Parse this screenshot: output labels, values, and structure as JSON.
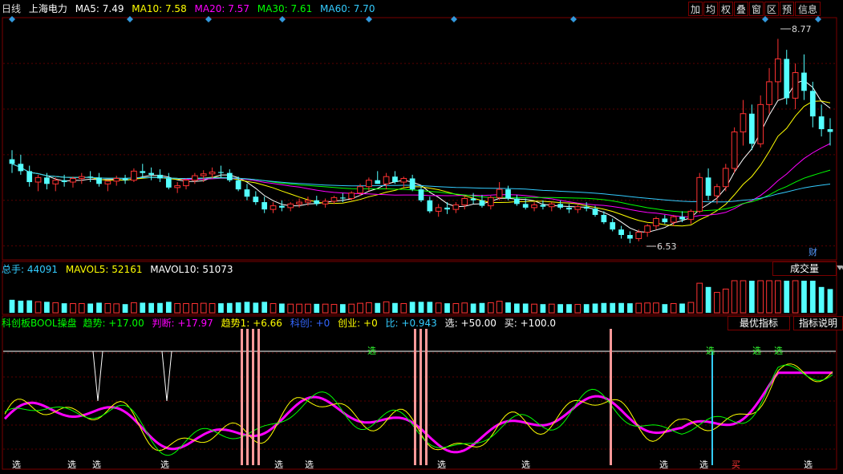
{
  "header": {
    "period": "日线",
    "name": "上海电力",
    "ma": [
      {
        "label": "MA5: 7.49",
        "color": "#ffffff"
      },
      {
        "label": "MA10: 7.58",
        "color": "#ffff00"
      },
      {
        "label": "MA20: 7.57",
        "color": "#ff00ff"
      },
      {
        "label": "MA30: 7.61",
        "color": "#00ff00"
      },
      {
        "label": "MA60: 7.70",
        "color": "#33ccff"
      }
    ]
  },
  "toolbar": [
    {
      "label": "加",
      "name": "toolbar-add-button"
    },
    {
      "label": "均",
      "name": "toolbar-average-button"
    },
    {
      "label": "权",
      "name": "toolbar-rights-button"
    },
    {
      "label": "叠",
      "name": "toolbar-overlay-button"
    },
    {
      "label": "窗",
      "name": "toolbar-window-button"
    },
    {
      "label": "区",
      "name": "toolbar-range-button"
    },
    {
      "label": "预",
      "name": "toolbar-forecast-button"
    },
    {
      "label": "信息",
      "name": "toolbar-info-button"
    }
  ],
  "price_annotations": {
    "high": "8.77",
    "low": "6.53",
    "cai": "财"
  },
  "volume": {
    "items": [
      {
        "label": "总手: 44091",
        "color": "#33ccff"
      },
      {
        "label": "MAVOL5: 52161",
        "color": "#ffff00"
      },
      {
        "label": "MAVOL10: 51073",
        "color": "#ffffff"
      }
    ],
    "tab": "成交量"
  },
  "indicator": {
    "items": [
      {
        "label": "科创板BOOL操盘",
        "color": "#00ff00"
      },
      {
        "label": "趋势: +17.00",
        "color": "#00ff00"
      },
      {
        "label": "判断: +17.97",
        "color": "#ff00ff"
      },
      {
        "label": "趋势1: +6.66",
        "color": "#ffff00"
      },
      {
        "label": "科创: +0",
        "color": "#3366ff"
      },
      {
        "label": "创业: +0",
        "color": "#ffff00"
      },
      {
        "label": "比: +0.943",
        "color": "#33ccff"
      },
      {
        "label": "选: +50.00",
        "color": "#ffffff"
      },
      {
        "label": "买: +100.0",
        "color": "#ffffff"
      }
    ],
    "tabs": [
      "最优指标",
      "指标说明"
    ],
    "signal_select": "选",
    "signal_buy": "买"
  },
  "chart_data": {
    "type": "candlestick",
    "ylim": [
      6.4,
      8.95
    ],
    "grid": true,
    "candles": [
      [
        7.45,
        7.55,
        7.3,
        7.4
      ],
      [
        7.4,
        7.5,
        7.28,
        7.32
      ],
      [
        7.32,
        7.38,
        7.15,
        7.2
      ],
      [
        7.2,
        7.28,
        7.1,
        7.25
      ],
      [
        7.25,
        7.3,
        7.12,
        7.18
      ],
      [
        7.18,
        7.25,
        7.1,
        7.22
      ],
      [
        7.22,
        7.28,
        7.15,
        7.2
      ],
      [
        7.2,
        7.26,
        7.14,
        7.24
      ],
      [
        7.24,
        7.3,
        7.18,
        7.26
      ],
      [
        7.26,
        7.32,
        7.2,
        7.25
      ],
      [
        7.25,
        7.3,
        7.15,
        7.18
      ],
      [
        7.18,
        7.22,
        7.1,
        7.21
      ],
      [
        7.21,
        7.27,
        7.16,
        7.24
      ],
      [
        7.24,
        7.28,
        7.18,
        7.22
      ],
      [
        7.22,
        7.35,
        7.2,
        7.32
      ],
      [
        7.32,
        7.4,
        7.25,
        7.3
      ],
      [
        7.3,
        7.36,
        7.22,
        7.28
      ],
      [
        7.28,
        7.34,
        7.2,
        7.24
      ],
      [
        7.24,
        7.3,
        7.12,
        7.14
      ],
      [
        7.14,
        7.2,
        7.08,
        7.16
      ],
      [
        7.16,
        7.24,
        7.12,
        7.22
      ],
      [
        7.22,
        7.3,
        7.18,
        7.27
      ],
      [
        7.27,
        7.33,
        7.2,
        7.29
      ],
      [
        7.29,
        7.36,
        7.24,
        7.31
      ],
      [
        7.31,
        7.38,
        7.25,
        7.3
      ],
      [
        7.3,
        7.34,
        7.2,
        7.22
      ],
      [
        7.22,
        7.26,
        7.1,
        7.12
      ],
      [
        7.12,
        7.18,
        7.0,
        7.04
      ],
      [
        7.04,
        7.1,
        6.95,
        6.98
      ],
      [
        6.98,
        7.04,
        6.86,
        6.9
      ],
      [
        6.9,
        6.98,
        6.86,
        6.94
      ],
      [
        6.94,
        7.0,
        6.88,
        6.92
      ],
      [
        6.92,
        6.98,
        6.88,
        6.96
      ],
      [
        6.96,
        7.02,
        6.92,
        6.98
      ],
      [
        6.98,
        7.04,
        6.94,
        7.0
      ],
      [
        7.0,
        7.05,
        6.94,
        6.96
      ],
      [
        6.96,
        7.02,
        6.92,
        6.99
      ],
      [
        6.99,
        7.05,
        6.96,
        7.03
      ],
      [
        7.03,
        7.08,
        6.98,
        7.02
      ],
      [
        7.02,
        7.1,
        7.0,
        7.08
      ],
      [
        7.08,
        7.18,
        7.05,
        7.15
      ],
      [
        7.15,
        7.25,
        7.1,
        7.22
      ],
      [
        7.22,
        7.32,
        7.18,
        7.18
      ],
      [
        7.18,
        7.3,
        7.12,
        7.26
      ],
      [
        7.26,
        7.32,
        7.18,
        7.2
      ],
      [
        7.2,
        7.26,
        7.14,
        7.24
      ],
      [
        7.24,
        7.28,
        7.1,
        7.12
      ],
      [
        7.12,
        7.16,
        6.98,
        7.0
      ],
      [
        7.0,
        7.04,
        6.86,
        6.88
      ],
      [
        6.88,
        6.96,
        6.82,
        6.92
      ],
      [
        6.92,
        6.98,
        6.85,
        6.9
      ],
      [
        6.9,
        6.98,
        6.86,
        6.95
      ],
      [
        6.95,
        7.04,
        6.9,
        7.02
      ],
      [
        7.02,
        7.08,
        6.96,
        7.0
      ],
      [
        7.0,
        7.06,
        6.92,
        6.94
      ],
      [
        6.94,
        7.05,
        6.9,
        7.03
      ],
      [
        7.03,
        7.2,
        7.0,
        7.12
      ],
      [
        7.12,
        7.16,
        7.0,
        7.02
      ],
      [
        7.02,
        7.06,
        6.94,
        6.96
      ],
      [
        6.96,
        7.02,
        6.9,
        6.92
      ],
      [
        6.92,
        6.98,
        6.88,
        6.95
      ],
      [
        6.95,
        7.0,
        6.9,
        6.93
      ],
      [
        6.93,
        6.98,
        6.88,
        6.96
      ],
      [
        6.96,
        7.0,
        6.9,
        6.92
      ],
      [
        6.92,
        6.96,
        6.86,
        6.9
      ],
      [
        6.9,
        6.95,
        6.86,
        6.93
      ],
      [
        6.93,
        6.98,
        6.88,
        6.91
      ],
      [
        6.91,
        6.94,
        6.82,
        6.84
      ],
      [
        6.84,
        6.88,
        6.74,
        6.76
      ],
      [
        6.76,
        6.8,
        6.66,
        6.68
      ],
      [
        6.68,
        6.72,
        6.58,
        6.62
      ],
      [
        6.62,
        6.66,
        6.53,
        6.58
      ],
      [
        6.58,
        6.68,
        6.55,
        6.65
      ],
      [
        6.65,
        6.74,
        6.6,
        6.72
      ],
      [
        6.72,
        6.82,
        6.68,
        6.8
      ],
      [
        6.8,
        6.84,
        6.74,
        6.76
      ],
      [
        6.76,
        6.84,
        6.72,
        6.82
      ],
      [
        6.82,
        6.88,
        6.76,
        6.79
      ],
      [
        6.79,
        6.9,
        6.74,
        6.88
      ],
      [
        6.88,
        7.3,
        6.86,
        7.25
      ],
      [
        7.25,
        7.35,
        7.0,
        7.05
      ],
      [
        7.05,
        7.18,
        6.96,
        7.15
      ],
      [
        7.15,
        7.4,
        7.1,
        7.35
      ],
      [
        7.35,
        7.8,
        7.3,
        7.75
      ],
      [
        7.75,
        8.1,
        7.6,
        7.95
      ],
      [
        7.95,
        8.05,
        7.55,
        7.62
      ],
      [
        7.62,
        8.15,
        7.58,
        8.05
      ],
      [
        8.05,
        8.45,
        7.95,
        8.3
      ],
      [
        8.3,
        8.77,
        8.1,
        8.55
      ],
      [
        8.55,
        8.65,
        8.05,
        8.12
      ],
      [
        8.12,
        8.5,
        8.0,
        8.4
      ],
      [
        8.4,
        8.6,
        8.1,
        8.2
      ],
      [
        8.2,
        8.3,
        7.8,
        7.92
      ],
      [
        7.92,
        8.05,
        7.7,
        7.78
      ],
      [
        7.78,
        7.9,
        7.6,
        7.75
      ]
    ]
  }
}
